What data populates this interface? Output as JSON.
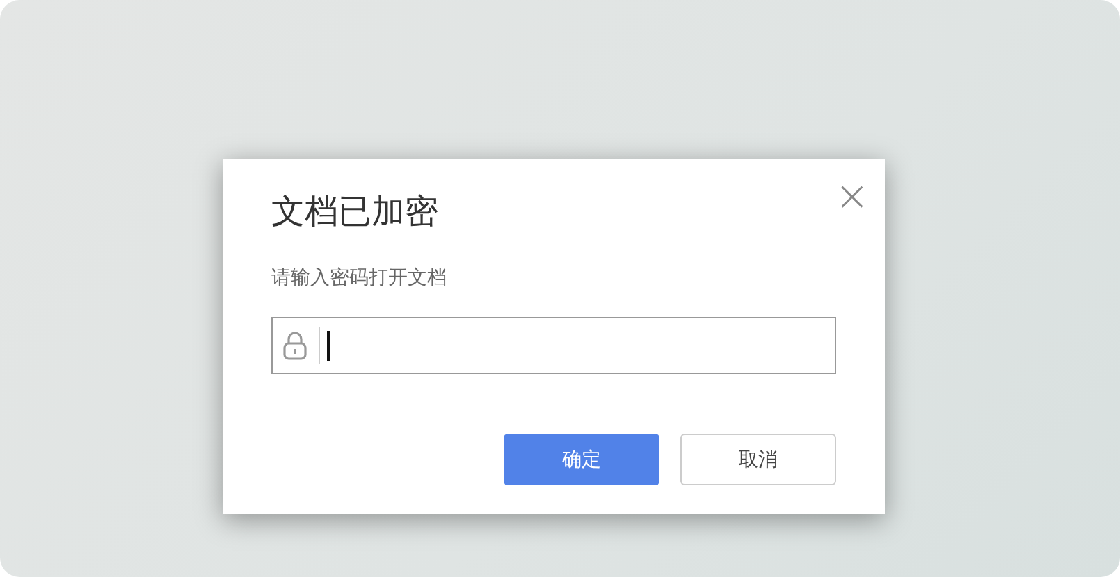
{
  "dialog": {
    "title": "文档已加密",
    "close": "×",
    "prompt": "请输入密码打开文档",
    "password_field": {
      "focused": true
    },
    "buttons": [
      {
        "label": "确定",
        "kind": "primary"
      },
      {
        "label": "取消",
        "kind": "secondary"
      }
    ]
  }
}
